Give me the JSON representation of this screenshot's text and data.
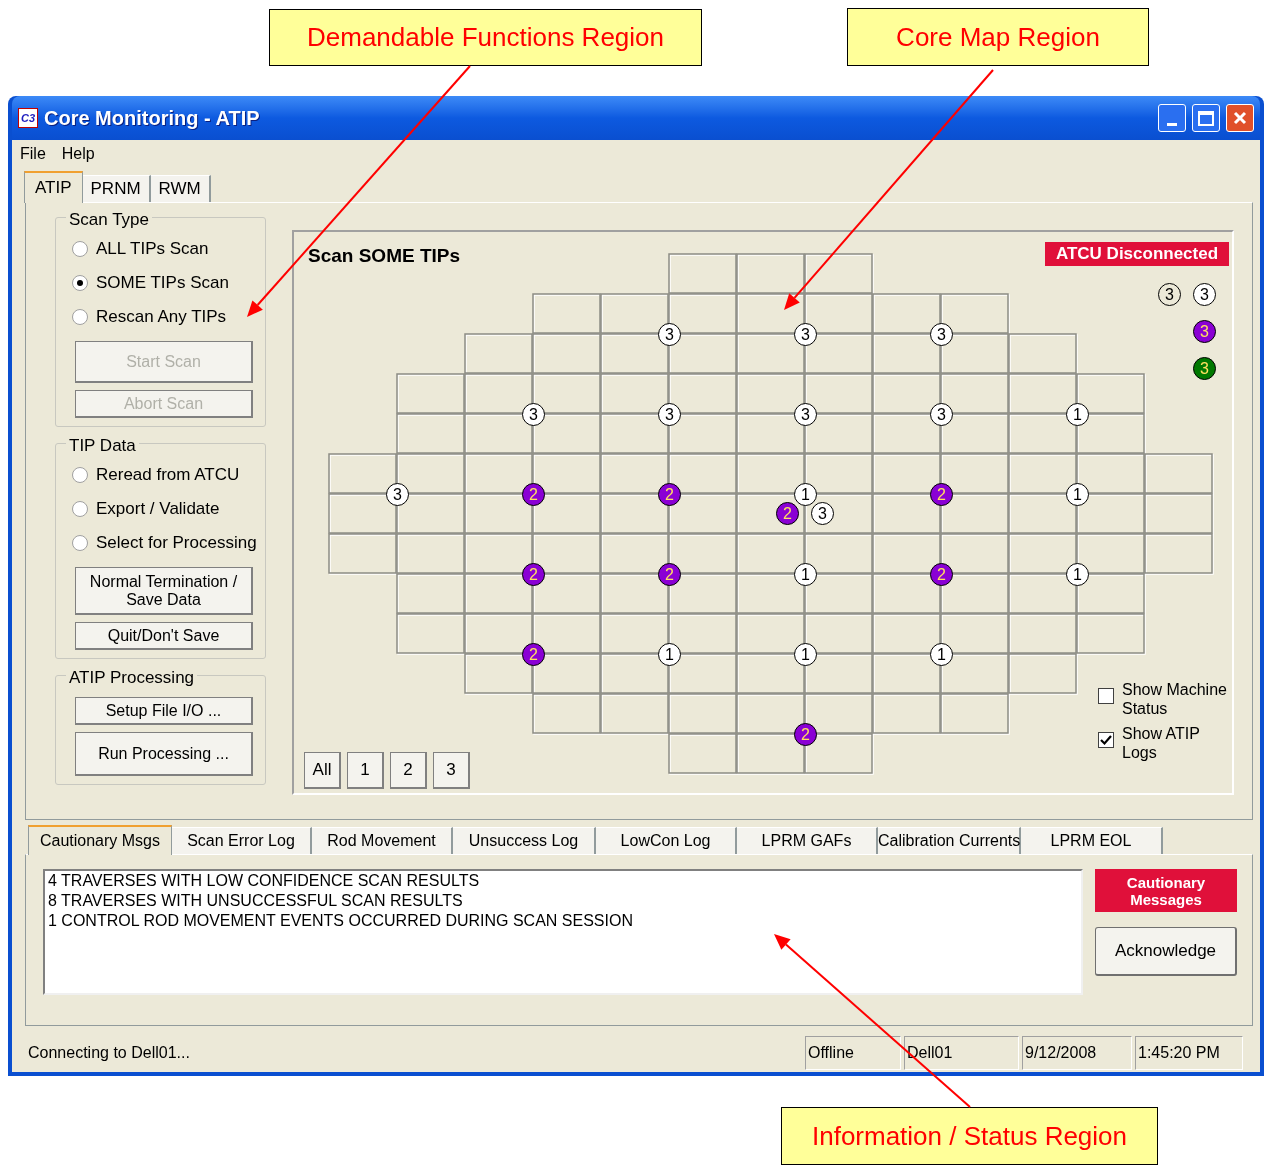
{
  "annotations": [
    {
      "text": "Demandable Functions Region"
    },
    {
      "text": "Core Map Region"
    },
    {
      "text": "Information / Status Region"
    }
  ],
  "window": {
    "icon_label": "C3",
    "title": "Core Monitoring - ATIP"
  },
  "menu": [
    "File",
    "Help"
  ],
  "tabs": [
    {
      "label": "ATIP",
      "selected": true
    },
    {
      "label": "PRNM",
      "selected": false
    },
    {
      "label": "RWM",
      "selected": false
    }
  ],
  "groups": [
    {
      "title": "Scan Type",
      "options": [
        {
          "label": "ALL TIPs Scan",
          "selected": false
        },
        {
          "label": "SOME TIPs Scan",
          "selected": true
        },
        {
          "label": "Rescan Any TIPs",
          "selected": false
        }
      ],
      "buttons": [
        {
          "label": "Start Scan",
          "disabled": true
        },
        {
          "label": "Abort Scan",
          "disabled": true
        }
      ]
    },
    {
      "title": "TIP Data",
      "options": [
        {
          "label": "Reread from ATCU",
          "selected": false
        },
        {
          "label": "Export / Validate",
          "selected": false
        },
        {
          "label": "Select for Processing",
          "selected": false
        }
      ],
      "buttons": [
        {
          "label": "Normal Termination / Save Data",
          "disabled": false
        },
        {
          "label": "Quit/Don't Save",
          "disabled": false
        }
      ]
    },
    {
      "title": "ATIP Processing",
      "buttons": [
        {
          "label": "Setup File I/O ...",
          "disabled": false
        },
        {
          "label": "Run Processing ...",
          "disabled": false
        }
      ]
    }
  ],
  "core_map": {
    "title": "Scan SOME TIPs",
    "status_badge": "ATCU Disconnected",
    "legend": [
      [
        {
          "label": "3",
          "color": "#ece9d8"
        },
        {
          "label": "3",
          "color": "#ffffff"
        }
      ],
      [
        {
          "label": "3",
          "color": "#8a00d4"
        }
      ],
      [
        {
          "label": "3",
          "color": "#007800"
        }
      ]
    ],
    "rows": [
      {
        "slots": [
          {
            "markers": [
              {
                "label": "3",
                "color": "#ffffff"
              }
            ]
          },
          {
            "markers": [
              {
                "label": "3",
                "color": "#ffffff"
              }
            ]
          },
          {
            "markers": [
              {
                "label": "3",
                "color": "#ffffff"
              }
            ]
          }
        ]
      },
      {
        "slots": [
          {
            "markers": [
              {
                "label": "3",
                "color": "#ffffff"
              }
            ]
          },
          {
            "markers": [
              {
                "label": "3",
                "color": "#ffffff"
              }
            ]
          },
          {
            "markers": [
              {
                "label": "3",
                "color": "#ffffff"
              }
            ]
          },
          {
            "markers": [
              {
                "label": "3",
                "color": "#ffffff"
              }
            ]
          },
          {
            "markers": [
              {
                "label": "1",
                "color": "#ffffff"
              }
            ]
          }
        ]
      },
      {
        "slots": [
          {
            "markers": [
              {
                "label": "3",
                "color": "#ffffff"
              }
            ]
          },
          {
            "markers": [
              {
                "label": "2",
                "color": "#8a00d4"
              }
            ]
          },
          {
            "markers": [
              {
                "label": "2",
                "color": "#8a00d4"
              }
            ]
          },
          {
            "markers": [
              {
                "label": "1",
                "color": "#ffffff"
              },
              {
                "label": "2",
                "color": "#8a00d4"
              },
              {
                "label": "3",
                "color": "#ffffff"
              }
            ]
          },
          {
            "markers": [
              {
                "label": "2",
                "color": "#8a00d4"
              }
            ]
          },
          {
            "markers": [
              {
                "label": "1",
                "color": "#ffffff"
              }
            ]
          }
        ]
      },
      {
        "slots": [
          {
            "markers": [
              {
                "label": "2",
                "color": "#8a00d4"
              }
            ]
          },
          {
            "markers": [
              {
                "label": "2",
                "color": "#8a00d4"
              }
            ]
          },
          {
            "markers": [
              {
                "label": "1",
                "color": "#ffffff"
              }
            ]
          },
          {
            "markers": [
              {
                "label": "2",
                "color": "#8a00d4"
              }
            ]
          },
          {
            "markers": [
              {
                "label": "1",
                "color": "#ffffff"
              }
            ]
          }
        ]
      },
      {
        "slots": [
          {
            "markers": [
              {
                "label": "2",
                "color": "#8a00d4"
              }
            ]
          },
          {
            "markers": [
              {
                "label": "1",
                "color": "#ffffff"
              }
            ]
          },
          {
            "markers": [
              {
                "label": "1",
                "color": "#ffffff"
              }
            ]
          },
          {
            "markers": [
              {
                "label": "1",
                "color": "#ffffff"
              }
            ]
          }
        ]
      },
      {
        "slots": [
          {
            "markers": [
              {
                "label": "2",
                "color": "#8a00d4"
              }
            ]
          }
        ]
      }
    ],
    "filter_buttons": [
      "All",
      "1",
      "2",
      "3"
    ],
    "options": [
      {
        "label": "Show Machine Status",
        "checked": false
      },
      {
        "label": "Show ATIP Logs",
        "checked": true
      }
    ]
  },
  "log_tabs": [
    {
      "label": "Cautionary Msgs",
      "selected": true
    },
    {
      "label": "Scan Error Log",
      "selected": false
    },
    {
      "label": "Rod Movement",
      "selected": false
    },
    {
      "label": "Unsuccess Log",
      "selected": false
    },
    {
      "label": "LowCon Log",
      "selected": false
    },
    {
      "label": "LPRM GAFs",
      "selected": false
    },
    {
      "label": "Calibration Currents",
      "selected": false
    },
    {
      "label": "LPRM EOL",
      "selected": false
    }
  ],
  "messages": [
    "4 TRAVERSES WITH LOW CONFIDENCE SCAN RESULTS",
    "8 TRAVERSES WITH UNSUCCESSFUL SCAN RESULTS",
    "1 CONTROL ROD MOVEMENT EVENTS OCCURRED DURING SCAN SESSION"
  ],
  "cautionary_badge": "Cautionary Messages",
  "acknowledge_button": "Acknowledge",
  "status_bar": {
    "message": "Connecting to Dell01...",
    "panels": [
      "Offline",
      "Dell01",
      "9/12/2008",
      "1:45:20 PM"
    ]
  }
}
